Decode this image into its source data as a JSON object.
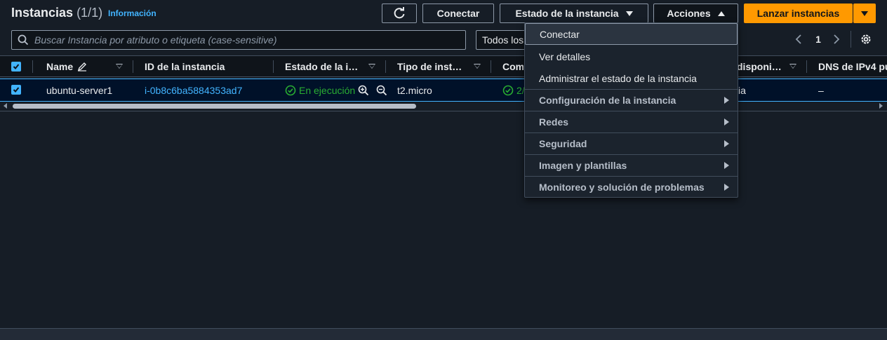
{
  "header": {
    "title": "Instancias",
    "count": "(1/1)",
    "info_link": "Información"
  },
  "toolbar": {
    "connect_label": "Conectar",
    "instance_state_label": "Estado de la instancia",
    "actions_label": "Acciones",
    "launch_label": "Lanzar instancias"
  },
  "search": {
    "placeholder": "Buscar Instancia por atributo o etiqueta (case-sensitive)",
    "filter_selected": "Todos los"
  },
  "pagination": {
    "current_page": "1"
  },
  "table": {
    "columns": [
      "Name",
      "ID de la instancia",
      "Estado de la i…",
      "Tipo de inst…",
      "Com",
      "disponi…",
      "DNS de IPv4 pú"
    ],
    "rows": [
      {
        "name": "ubuntu-server1",
        "instance_id": "i-0b8c6ba5884353ad7",
        "state": "En ejecución",
        "type": "t2.micro",
        "checks": "2/",
        "availability": "ia",
        "dns": "–"
      }
    ]
  },
  "actions_menu": {
    "items": [
      "Conectar",
      "Ver detalles",
      "Administrar el estado de la instancia"
    ],
    "groups": [
      "Configuración de la instancia",
      "Redes",
      "Seguridad",
      "Imagen y plantillas",
      "Monitoreo y solución de problemas"
    ]
  },
  "colors": {
    "background": "#161d26",
    "link": "#42b4ff",
    "running": "#29ad32",
    "primary": "#ff9900"
  }
}
